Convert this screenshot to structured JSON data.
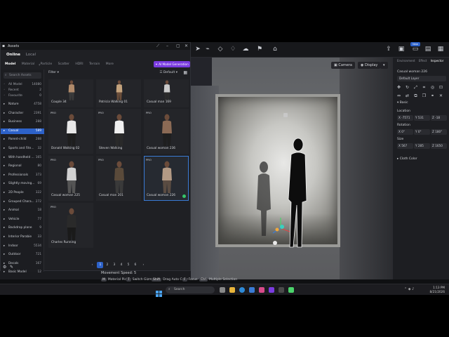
{
  "assets": {
    "title": "Assets",
    "scope_tabs": [
      {
        "label": "Online",
        "active": true
      },
      {
        "label": "Local",
        "active": false
      }
    ],
    "type_tabs": [
      {
        "label": "Model",
        "active": true
      },
      {
        "label": "Material",
        "active": false
      },
      {
        "label": "Particle",
        "active": false
      },
      {
        "label": "Scatter",
        "active": false
      },
      {
        "label": "HDRI",
        "active": false
      },
      {
        "label": "Terrain",
        "active": false
      },
      {
        "label": "More",
        "active": false
      }
    ],
    "ai_button": "AI Model Generation",
    "search_placeholder": "Search Assets",
    "sidebar": [
      {
        "label": "All Model",
        "count": "14080",
        "kind": "top"
      },
      {
        "label": "Recent",
        "count": "2",
        "kind": "top"
      },
      {
        "label": "Favourite",
        "count": "0",
        "kind": "top"
      },
      {
        "label": "Nature",
        "count": "4758"
      },
      {
        "label": "Character",
        "count": "2391"
      },
      {
        "label": "Business",
        "count": "288"
      },
      {
        "label": "Casual",
        "count": "589",
        "active": true
      },
      {
        "label": "Parent-child",
        "count": "288"
      },
      {
        "label": "Sports and Fitn...",
        "count": "32"
      },
      {
        "label": "With handheld ...",
        "count": "165"
      },
      {
        "label": "Regional",
        "count": "80"
      },
      {
        "label": "Professionals",
        "count": "373"
      },
      {
        "label": "Slightly moving...",
        "count": "69"
      },
      {
        "label": "2D People",
        "count": "322"
      },
      {
        "label": "Grouped Chara...",
        "count": "272"
      },
      {
        "label": "Animal",
        "count": "18"
      },
      {
        "label": "Vehicle",
        "count": "77"
      },
      {
        "label": "Backdrop plane",
        "count": "9"
      },
      {
        "label": "Interior Parabie",
        "count": "33"
      },
      {
        "label": "Indoor",
        "count": "5534"
      },
      {
        "label": "Outdoor",
        "count": "721"
      },
      {
        "label": "Decals",
        "count": "167"
      },
      {
        "label": "Basic Model",
        "count": "12"
      }
    ],
    "filter_label": "Filter",
    "sort_label": "Default",
    "cards": [
      {
        "label": "Couple 34",
        "badge": ""
      },
      {
        "label": "Patricia Walking 01",
        "badge": ""
      },
      {
        "label": "Casual man 169",
        "badge": ""
      },
      {
        "label": "Donald Walking 02",
        "badge": "PRO"
      },
      {
        "label": "Steven Walking",
        "badge": "PRO"
      },
      {
        "label": "Casual woman 236",
        "badge": "PRO"
      },
      {
        "label": "Casual woman 225",
        "badge": "PRO"
      },
      {
        "label": "Casual man 201",
        "badge": "PRO"
      },
      {
        "label": "Casual woman 226",
        "badge": "PRO"
      },
      {
        "label": "Charles Running",
        "badge": "PRO"
      }
    ],
    "pages": [
      "1",
      "2",
      "3",
      "4",
      "5",
      "6"
    ],
    "active_page": "1"
  },
  "viewport": {
    "camera_btn": "Camera",
    "display_btn": "Display",
    "speed": "Movement Speed: 5"
  },
  "hints": [
    {
      "key": "M",
      "label": "Material Picker"
    },
    {
      "key": "T",
      "label": "Switch Gizmos"
    },
    {
      "key": "Shift",
      "label": "Drag Auto Copy"
    },
    {
      "key": "F",
      "label": "Focus"
    },
    {
      "key": "Ctrl",
      "label": "Multiple Selection"
    }
  ],
  "inspector": {
    "tabs": [
      {
        "label": "Environment",
        "active": false
      },
      {
        "label": "Effect",
        "active": false
      },
      {
        "label": "Inspector",
        "active": true
      }
    ],
    "object_name": "Casual woman 226",
    "layer": "Default Layer",
    "basic_label": "Basic",
    "location_label": "Location",
    "location": {
      "x": "X -7571",
      "y": "Y 531",
      "z": "Z -18"
    },
    "rotation_label": "Rotation",
    "rotation": {
      "x": "X 0°",
      "y": "Y 0°",
      "z": "Z 180°"
    },
    "size_label": "Size",
    "size": {
      "x": "X 567",
      "y": "Y 285",
      "z": "Z 1650"
    },
    "cloth_label": "Cloth Color",
    "new_badge": "New"
  },
  "taskbar": {
    "search": "Search",
    "time": "1:13 PM",
    "date": "8/21/2026"
  },
  "colors": {
    "accent": "#2d62c9",
    "ai_purple": "#7a3be0",
    "selected_border": "#3a7bd5",
    "ok_green": "#35c46a"
  }
}
